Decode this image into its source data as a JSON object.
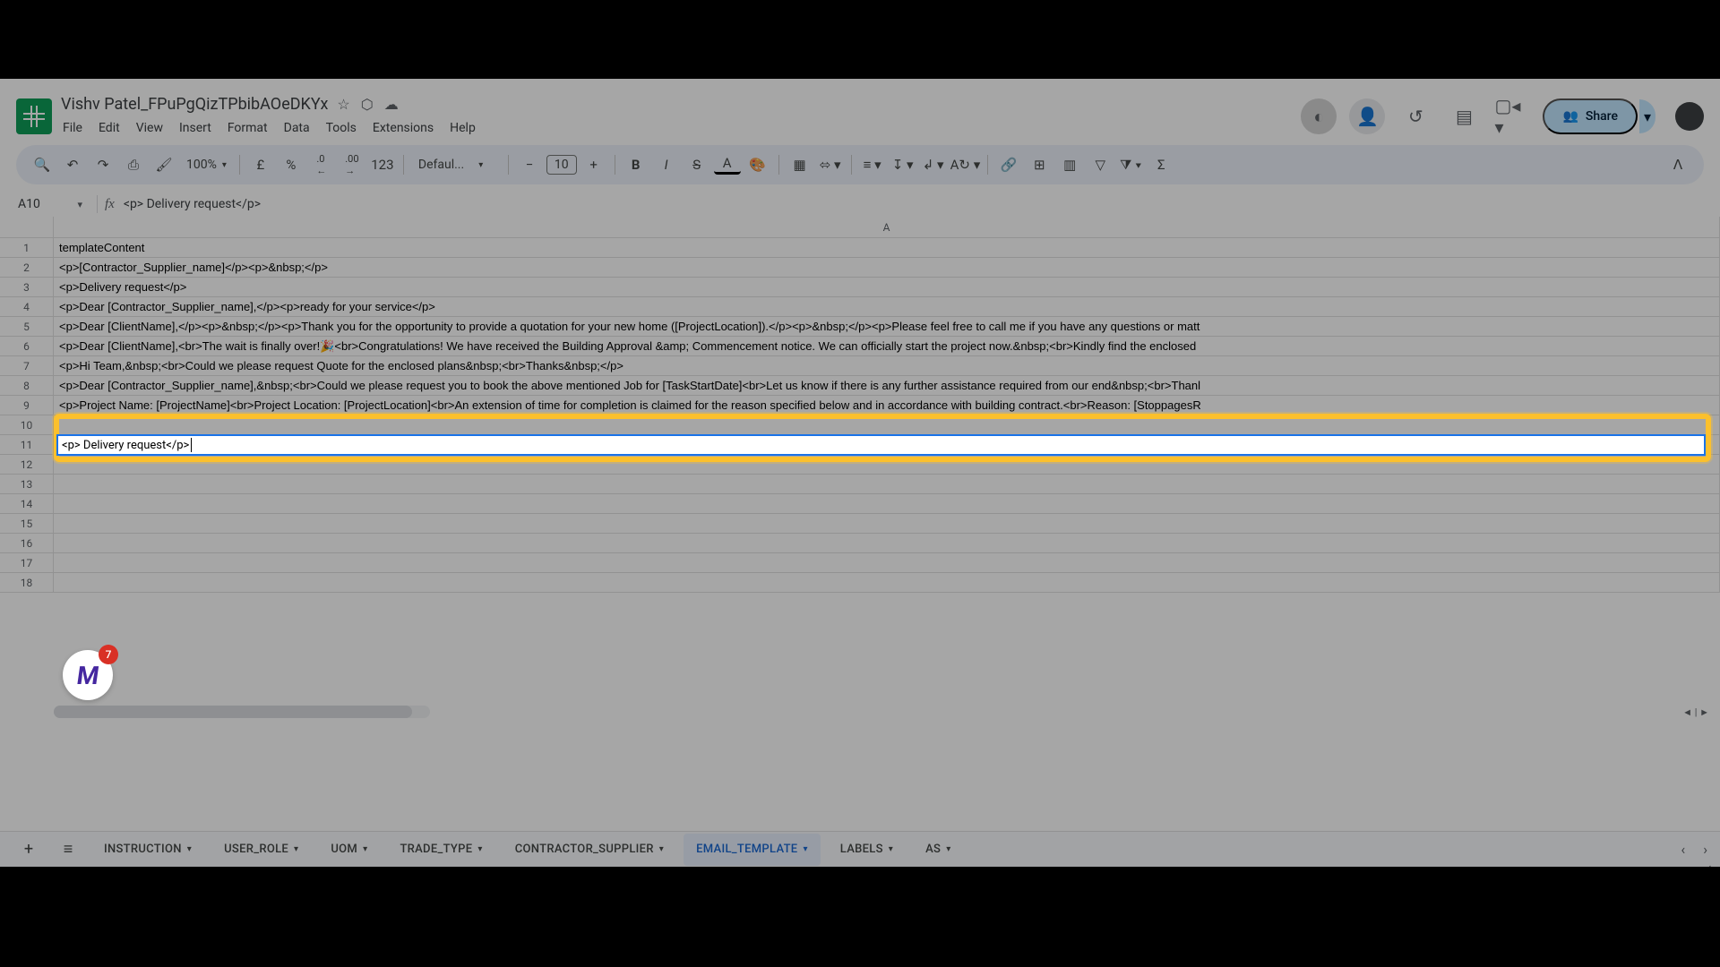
{
  "header": {
    "title": "Vishv Patel_FPuPgQizTPbibAOeDKYx",
    "menus": [
      "File",
      "Edit",
      "View",
      "Insert",
      "Format",
      "Data",
      "Tools",
      "Extensions",
      "Help"
    ],
    "share_label": "Share"
  },
  "toolbar": {
    "zoom": "100%",
    "currency": "£",
    "percent": "%",
    "dec_down": ".0",
    "dec_up": ".00",
    "num_format": "123",
    "font_name": "Defaul...",
    "font_size": "10"
  },
  "name_box": "A10",
  "formula": "<p> Delivery request</p>",
  "columns": [
    "A"
  ],
  "rows": [
    {
      "n": 1,
      "v": "templateContent"
    },
    {
      "n": 2,
      "v": "<p>[Contractor_Supplier_name]</p><p>&nbsp;</p>"
    },
    {
      "n": 3,
      "v": "<p>Delivery request</p>"
    },
    {
      "n": 4,
      "v": "<p>Dear [Contractor_Supplier_name],</p><p>ready for your service</p>"
    },
    {
      "n": 5,
      "v": "<p>Dear [ClientName],</p><p>&nbsp;</p><p>Thank you for the opportunity to provide a quotation for your new home ([ProjectLocation]).</p><p>&nbsp;</p><p>Please feel free to call me if you have any questions or matt"
    },
    {
      "n": 6,
      "v": "<p>Dear [ClientName],<br>The wait is finally over!🎉<br>Congratulations! We have received the Building Approval &amp; Commencement notice. We can officially start the project now.&nbsp;<br>Kindly find the enclosed"
    },
    {
      "n": 7,
      "v": "<p>Hi Team,&nbsp;<br>Could we please request Quote for the enclosed plans&nbsp;<br>Thanks&nbsp;</p>"
    },
    {
      "n": 8,
      "v": "<p>Dear [Contractor_Supplier_name],&nbsp;<br>Could we please request you to book the above mentioned Job for [TaskStartDate]<br>Let us know if there is any further assistance required from our end&nbsp;<br>Thanl"
    },
    {
      "n": 9,
      "v": "<p>Project Name: [ProjectName]<br>Project Location: [ProjectLocation]<br>An extension of time for completion is claimed for the reason specified below and in accordance with building contract.<br>Reason: [StoppagesR"
    },
    {
      "n": 10,
      "v": ""
    },
    {
      "n": 11,
      "v": ""
    },
    {
      "n": 12,
      "v": ""
    },
    {
      "n": 13,
      "v": ""
    },
    {
      "n": 14,
      "v": ""
    },
    {
      "n": 15,
      "v": ""
    },
    {
      "n": 16,
      "v": ""
    },
    {
      "n": 17,
      "v": ""
    },
    {
      "n": 18,
      "v": ""
    }
  ],
  "editing_cell_value": "<p> Delivery request</p> ",
  "sheet_tabs": [
    {
      "label": "INSTRUCTION",
      "active": false
    },
    {
      "label": "USER_ROLE",
      "active": false
    },
    {
      "label": "UOM",
      "active": false
    },
    {
      "label": "TRADE_TYPE",
      "active": false
    },
    {
      "label": "CONTRACTOR_SUPPLIER",
      "active": false
    },
    {
      "label": "EMAIL_TEMPLATE",
      "active": true
    },
    {
      "label": "LABELS",
      "active": false
    },
    {
      "label": "AS",
      "active": false
    }
  ],
  "badge": {
    "letter": "M",
    "count": "7"
  }
}
